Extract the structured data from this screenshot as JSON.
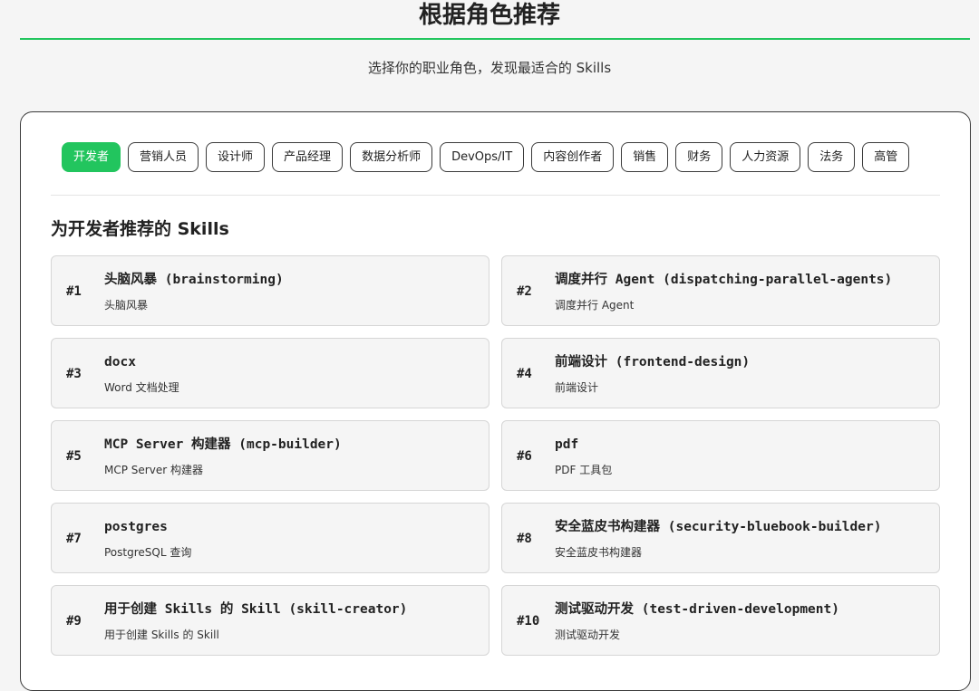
{
  "page": {
    "title": "根据角色推荐",
    "subtitle": "选择你的职业角色，发现最适合的 Skills"
  },
  "roles": [
    {
      "label": "开发者",
      "active": true
    },
    {
      "label": "营销人员",
      "active": false
    },
    {
      "label": "设计师",
      "active": false
    },
    {
      "label": "产品经理",
      "active": false
    },
    {
      "label": "数据分析师",
      "active": false
    },
    {
      "label": "DevOps/IT",
      "active": false
    },
    {
      "label": "内容创作者",
      "active": false
    },
    {
      "label": "销售",
      "active": false
    },
    {
      "label": "财务",
      "active": false
    },
    {
      "label": "人力资源",
      "active": false
    },
    {
      "label": "法务",
      "active": false
    },
    {
      "label": "高管",
      "active": false
    }
  ],
  "section": {
    "title": "为开发者推荐的 Skills"
  },
  "skills": [
    {
      "rank": "#1",
      "name": "头脑风暴 (brainstorming)",
      "desc": "头脑风暴"
    },
    {
      "rank": "#2",
      "name": "调度并行 Agent (dispatching-parallel-agents)",
      "desc": "调度并行 Agent"
    },
    {
      "rank": "#3",
      "name": "docx",
      "desc": "Word 文档处理"
    },
    {
      "rank": "#4",
      "name": "前端设计 (frontend-design)",
      "desc": "前端设计"
    },
    {
      "rank": "#5",
      "name": "MCP Server 构建器 (mcp-builder)",
      "desc": "MCP Server 构建器"
    },
    {
      "rank": "#6",
      "name": "pdf",
      "desc": "PDF 工具包"
    },
    {
      "rank": "#7",
      "name": "postgres",
      "desc": "PostgreSQL 查询"
    },
    {
      "rank": "#8",
      "name": "安全蓝皮书构建器 (security-bluebook-builder)",
      "desc": "安全蓝皮书构建器"
    },
    {
      "rank": "#9",
      "name": "用于创建 Skills 的 Skill (skill-creator)",
      "desc": "用于创建 Skills 的 Skill"
    },
    {
      "rank": "#10",
      "name": "测试驱动开发 (test-driven-development)",
      "desc": "测试驱动开发"
    }
  ],
  "colors": {
    "accent": "#22c55e",
    "background": "#f5f5f5",
    "card": "#f5f5f5"
  }
}
